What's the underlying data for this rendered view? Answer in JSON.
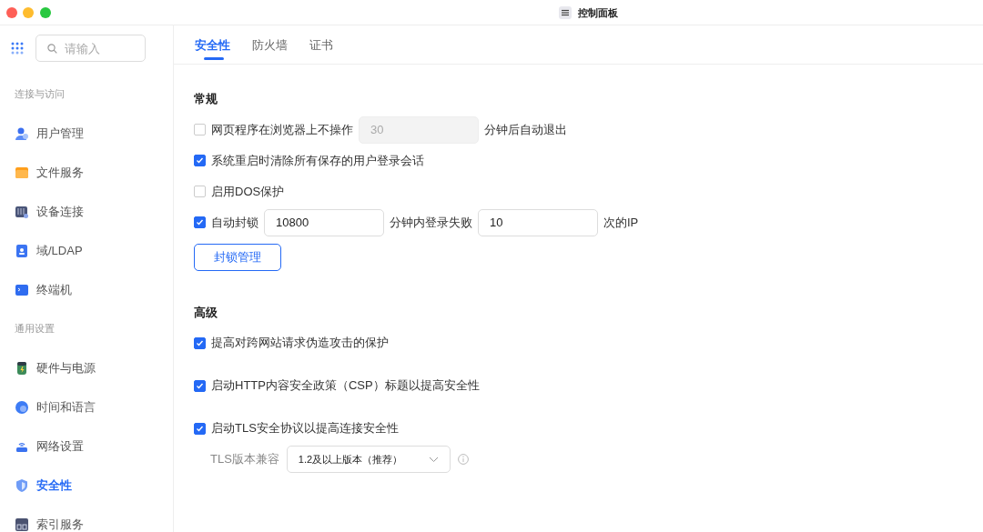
{
  "window": {
    "title": "控制面板"
  },
  "sidebar": {
    "search": {
      "placeholder": "请输入"
    },
    "groups": [
      {
        "label": "连接与访问",
        "items": [
          {
            "label": "用户管理",
            "selected": false
          },
          {
            "label": "文件服务",
            "selected": false
          },
          {
            "label": "设备连接",
            "selected": false
          },
          {
            "label": "域/LDAP",
            "selected": false
          },
          {
            "label": "终端机",
            "selected": false
          }
        ]
      },
      {
        "label": "通用设置",
        "items": [
          {
            "label": "硬件与电源",
            "selected": false
          },
          {
            "label": "时间和语言",
            "selected": false
          },
          {
            "label": "网络设置",
            "selected": false
          },
          {
            "label": "安全性",
            "selected": true
          },
          {
            "label": "索引服务",
            "selected": false
          }
        ]
      }
    ]
  },
  "tabs": [
    {
      "label": "安全性",
      "selected": true
    },
    {
      "label": "防火墙",
      "selected": false
    },
    {
      "label": "证书",
      "selected": false
    }
  ],
  "sections": [
    {
      "title": "常规",
      "rows": [
        {
          "kind": "check",
          "checked": false,
          "parts": [
            {
              "kind": "text",
              "text": "网页程序在浏览器上不操作"
            },
            {
              "kind": "input",
              "value": "30",
              "disabled": true
            },
            {
              "kind": "text",
              "text": "分钟后自动退出"
            }
          ]
        },
        {
          "kind": "check",
          "checked": true,
          "parts": [
            {
              "kind": "text",
              "text": "系统重启时清除所有保存的用户登录会话"
            }
          ]
        },
        {
          "kind": "check",
          "checked": false,
          "parts": [
            {
              "kind": "text",
              "text": "启用DOS保护"
            }
          ]
        },
        {
          "kind": "check",
          "checked": true,
          "parts": [
            {
              "kind": "text",
              "text": "自动封锁"
            },
            {
              "kind": "input",
              "value": "10800",
              "disabled": false
            },
            {
              "kind": "text",
              "text": "分钟内登录失败"
            },
            {
              "kind": "input",
              "value": "10",
              "disabled": false
            },
            {
              "kind": "text",
              "text": "次的IP"
            }
          ]
        },
        {
          "kind": "button",
          "label": "封锁管理"
        }
      ]
    },
    {
      "title": "高级",
      "rows": [
        {
          "kind": "check",
          "checked": true,
          "parts": [
            {
              "kind": "text",
              "text": "提高对跨网站请求伪造攻击的保护"
            }
          ]
        },
        {
          "kind": "check",
          "checked": true,
          "parts": [
            {
              "kind": "text",
              "text": "启动HTTP内容安全政策（CSP）标题以提高安全性"
            }
          ]
        },
        {
          "kind": "check",
          "checked": true,
          "parts": [
            {
              "kind": "text",
              "text": "启动TLS安全协议以提高连接安全性"
            }
          ]
        },
        {
          "kind": "select",
          "label": "TLS版本兼容",
          "value": "1.2及以上版本（推荐）"
        }
      ]
    }
  ]
}
